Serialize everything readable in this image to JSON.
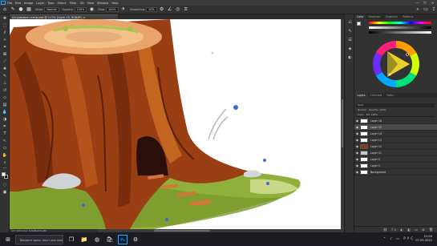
{
  "menubar": {
    "logo": "Ps",
    "items": [
      "File",
      "Edit",
      "Image",
      "Layer",
      "Type",
      "Select",
      "Filter",
      "3D",
      "View",
      "Window",
      "Help"
    ],
    "minimize": "—",
    "maximize": "❐",
    "close": "✕"
  },
  "options_bar": {
    "mode_label": "Mode:",
    "mode_value": "Normal",
    "opacity_label": "Opacity:",
    "opacity_value": "100%",
    "flow_label": "Flow:",
    "flow_value": "100%",
    "smoothing_label": "Smoothing:",
    "smoothing_value": "10%"
  },
  "document": {
    "tab_title": "Штурмовое стенд.psd @ 117% (Layer 15, RGB/8*) ×",
    "status": "117,44%    Doc: 6,84M/233,4M"
  },
  "panels": {
    "color_tabs": [
      "Color",
      "Swatches",
      "Gradients",
      "Patterns"
    ],
    "layers_tabs": [
      "Layers",
      "Channels",
      "Paths"
    ],
    "filter_label": "Kind",
    "mode_label": "Normal",
    "opacity_label": "Opacity: 100%",
    "lock_label": "Lock:",
    "fill_label": "Fill: 100%",
    "layers": [
      {
        "name": "Layer 16",
        "selected": false
      },
      {
        "name": "Layer 15",
        "selected": true
      },
      {
        "name": "Layer 14",
        "selected": false
      },
      {
        "name": "Layer 13",
        "selected": false
      },
      {
        "name": "Layer 12",
        "selected": false
      },
      {
        "name": "Layer 11",
        "selected": false
      },
      {
        "name": "Layer 2",
        "selected": false
      },
      {
        "name": "Layer 1",
        "selected": false
      },
      {
        "name": "Background",
        "selected": false
      }
    ],
    "footer_icons": "⛓ fx ◐ ◧ ▭ ⊞ 🗑"
  },
  "taskbar": {
    "search_placeholder": "Введите здесь текст для поиска",
    "lang": "РУС",
    "time": "21:04",
    "date": "07.05.2021"
  },
  "colors": {
    "accent": "#31a8ff",
    "foreground": "#ffffff",
    "background": "#0c0c0c"
  }
}
